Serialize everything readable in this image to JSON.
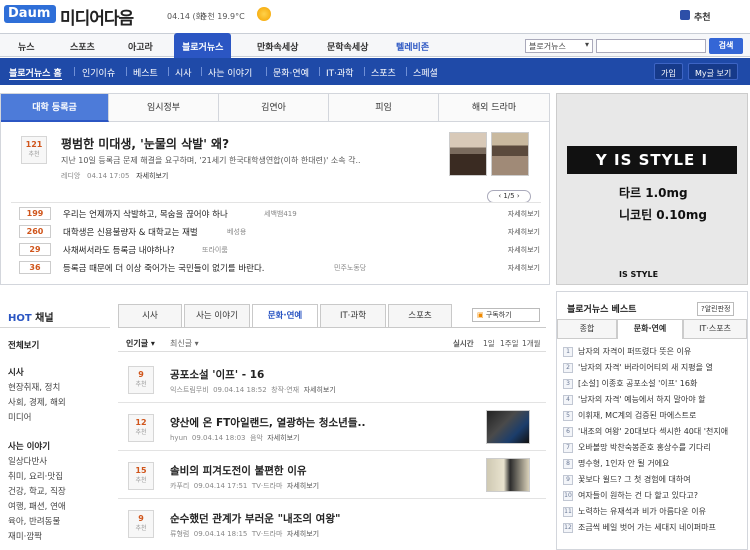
{
  "header": {
    "logo": "Daum",
    "brand": "미디어다음",
    "date": "04.14 (화)",
    "weather": "춘천 19.9°C",
    "recommend": "추천"
  },
  "nav": {
    "items": [
      "뉴스",
      "스포츠",
      "아고라",
      "블로거뉴스",
      "만화속세상",
      "문학속세상",
      "텔레비존"
    ],
    "search_select": "블로거뉴스",
    "search_button": "검색"
  },
  "subnav": {
    "items": [
      "블로거뉴스 홈",
      "인기이슈",
      "베스트",
      "시사",
      "사는 이야기",
      "문화·연예",
      "IT·과학",
      "스포츠",
      "스페셜"
    ],
    "join": "가입",
    "my": "My글 보기"
  },
  "feature": {
    "tabs": [
      "대학 등록금",
      "임시정부",
      "김연아",
      "피임",
      "해외 드라마"
    ],
    "main": {
      "count": "121",
      "count_label": "추천",
      "title": "평범한 미대생, '눈물의 삭발' 왜?",
      "desc": "지난 10일 등록금 문제 해결을 요구하며, '21세기 한국대학생연합(이하 한대련)' 소속 각..",
      "author": "레디앙",
      "time": "04.14 17:05",
      "more": "자세히보기"
    },
    "pager": "‹ 1/5 ›",
    "list": [
      {
        "count": "199",
        "title": "우리는 언제까지 삭발하고, 목숨을 끊어야 하나",
        "author": "세백뱀419",
        "more": "자세히보기"
      },
      {
        "count": "260",
        "title": "대학생은 신용불량자 & 대학교는 재벌",
        "author": "베성용",
        "more": "자세히보기"
      },
      {
        "count": "29",
        "title": "사채써서라도 등록금 내야하나?",
        "author": "또라이룸",
        "more": "자세히보기"
      },
      {
        "count": "36",
        "title": "등록금 때문에 더 이상 죽어가는 국민들이 없기를 바란다.",
        "author": "민주노동당",
        "more": "자세히보기"
      }
    ]
  },
  "ad": {
    "headline": "IS STYLE I",
    "line1": "타르 1.0mg",
    "line2": "니코틴 0.10mg",
    "brand": "IS STYLE"
  },
  "left": {
    "hot_prefix": "HOT",
    "hot_suffix": " 채널",
    "all": "전체보기",
    "sec1": "시사",
    "sec1_items": [
      "현장취재, 정치",
      "사회, 경제, 해외",
      "미디어"
    ],
    "sec2": "사는 이야기",
    "sec2_items": [
      "일상다반사",
      "취미, 요리·맛집",
      "건강, 학교, 직장",
      "여행, 패션, 연애",
      "육아, 반려동물",
      "재미·깜짝"
    ]
  },
  "middle": {
    "tabs": [
      "시사",
      "사는 이야기",
      "문화·연예",
      "IT·과학",
      "스포츠"
    ],
    "subscribe": "구독하기",
    "sort_popular": "인기글 ▾",
    "sort_recent": "최신글 ▾",
    "ranges": [
      "실시간",
      "1일",
      "1주일",
      "1개월"
    ],
    "articles": [
      {
        "count": "9",
        "label": "추천",
        "title": "공포소설 '이프' - 16",
        "author": "익스트림무비",
        "time": "09.04.14 18:52",
        "cat": "창작·연재",
        "more": "자세히보기"
      },
      {
        "count": "12",
        "label": "추천",
        "title": "양산에 온 FT아일랜드, 열광하는 청소년들..",
        "author": "hyun",
        "time": "09.04.14 18:03",
        "cat": "음악",
        "more": "자세히보기"
      },
      {
        "count": "15",
        "label": "추천",
        "title": "솔비의 피겨도전이 불편한 이유",
        "author": "카푸리",
        "time": "09.04.14 17:51",
        "cat": "TV·드라마",
        "more": "자세히보기"
      },
      {
        "count": "9",
        "label": "추천",
        "title": "순수했던 관계가 부러운 \"내조의 여왕\"",
        "author": "류형럼",
        "time": "09.04.14 18:15",
        "cat": "TV·드라마",
        "more": "자세히보기"
      }
    ]
  },
  "right": {
    "title": "블로거뉴스 베스트",
    "link": "?알린판정",
    "tabs": [
      "종합",
      "문화·연예",
      "IT·스포츠"
    ],
    "items": [
      "남자의 자격이 퍼뜨렸다 뜻은 이유",
      "'남자의 자격' 버라이어티의 새 지평을 열",
      "[소설] 이종호 공포소설 '이프' 16화",
      "'남자의 자격' 예능에서 하지 말아야 할",
      "이휘재, MC계의 검증된 마에스트로",
      "'내조의 여왕' 20대보다 섹시한 40대 '천지애",
      "오바볼망 박찬숙봉준호 홍상수를 기다리",
      "명수형, 1인자 안 될 거에요",
      "꽃보다 윌드? 그 첫 경험에 대하여",
      "여자들이 원하는 건 다 할고 있다고?",
      "노력하는 유재석과 비가 아름다운 이유",
      "조금씩 베일 벗어 가는 세대지 네이퍼마프"
    ]
  },
  "colors": {
    "brand_blue": "#2b56c3",
    "subnav_blue": "#1f4aa8",
    "accent_orange": "#d0551b"
  }
}
